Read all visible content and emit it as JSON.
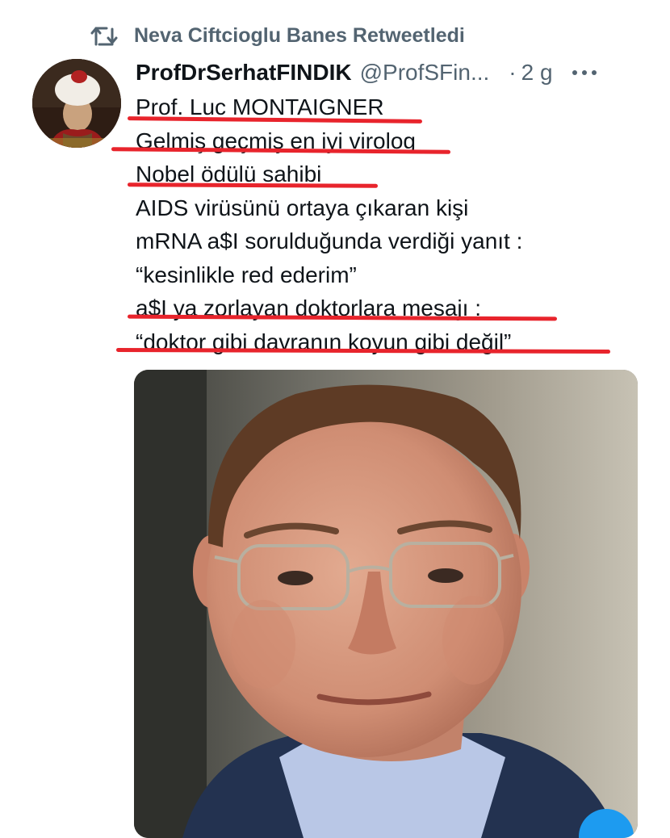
{
  "retweet": {
    "label": "Neva Ciftcioglu Banes Retweetledi",
    "icon": "retweet-icon"
  },
  "tweet": {
    "display_name": "ProfDrSerhatFINDIK",
    "handle": "@ProfSFin...",
    "separator": "·",
    "time": "2 g",
    "more_icon": "more-horizontal-icon",
    "lines": [
      "Prof. Luc MONTAIGNER",
      "Gelmiş geçmiş en iyi virolog",
      "Nobel ödülü sahibi",
      "AIDS virüsünü ortaya çıkaran kişi",
      "mRNA a$I sorulduğunda verdiği yanıt :",
      "“kesinlikle red ederim”",
      "a$I ya zorlayan doktorlara mesajı :",
      "“doktor gibi davranın koyun gibi değil”"
    ]
  },
  "colors": {
    "underline": "#e8242c",
    "secondary_text": "#536471",
    "primary_text": "#0f1419"
  }
}
